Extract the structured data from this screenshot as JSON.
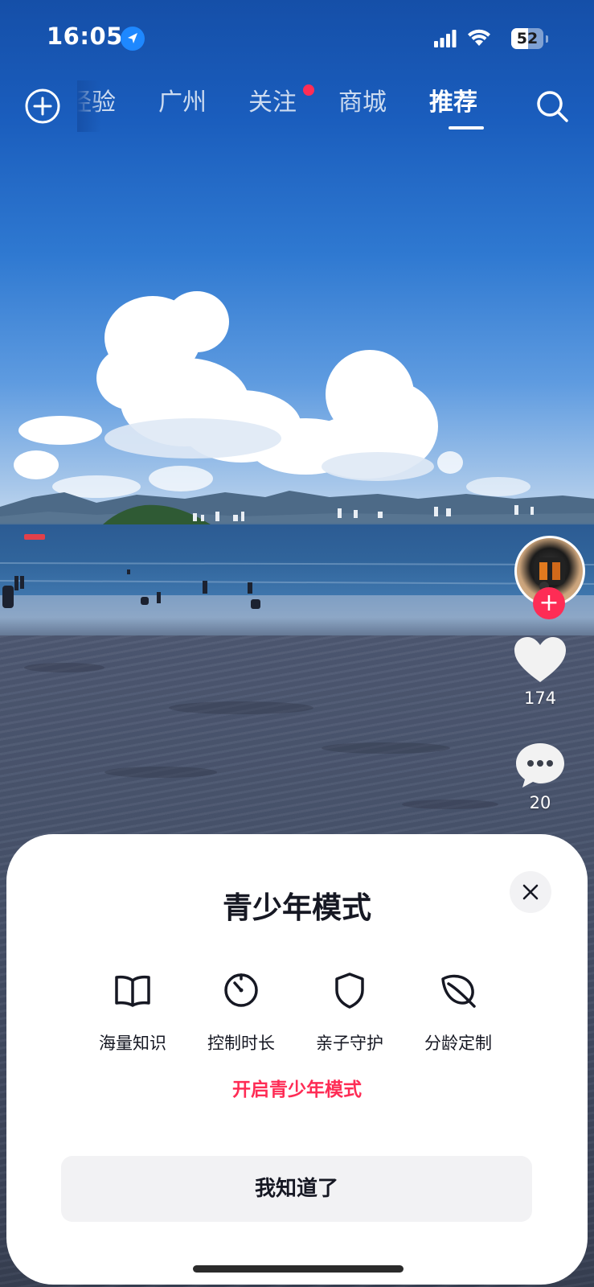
{
  "status_bar": {
    "time": "16:05",
    "battery": "52",
    "battery_level": 0.52
  },
  "top_nav": {
    "tabs": [
      {
        "label": "经验"
      },
      {
        "label": "广州"
      },
      {
        "label": "关注",
        "has_dot": true
      },
      {
        "label": "商城"
      },
      {
        "label": "推荐",
        "active": true
      }
    ]
  },
  "rail": {
    "like_count": "174",
    "comment_count": "20"
  },
  "sheet": {
    "title": "青少年模式",
    "features": [
      {
        "label": "海量知识",
        "icon": "book-icon"
      },
      {
        "label": "控制时长",
        "icon": "timer-icon"
      },
      {
        "label": "亲子守护",
        "icon": "shield-icon"
      },
      {
        "label": "分龄定制",
        "icon": "leaf-icon"
      }
    ],
    "enable_link": "开启青少年模式",
    "ok_button": "我知道了"
  },
  "colors": {
    "accent": "#fe2c55",
    "sheet_bg": "#ffffff",
    "button_bg": "#f2f2f4",
    "text": "#161823"
  }
}
